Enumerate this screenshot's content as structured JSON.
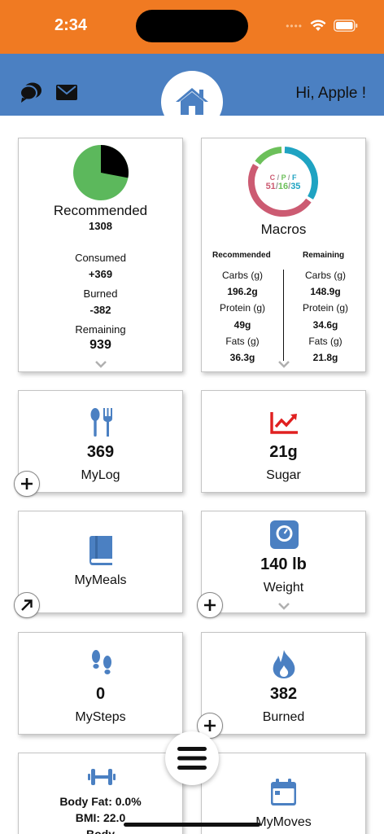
{
  "status_bar": {
    "time": "2:34",
    "bg_color": "#f07a22"
  },
  "header": {
    "greeting": "Hi, Apple !",
    "bg_color": "#4b80c2",
    "left_icons": [
      "chat-bubbles-icon",
      "mail-icon"
    ],
    "center_icon": "home-icon"
  },
  "calories_card": {
    "pie": {
      "consumed_fraction": 0.28,
      "consumed_color": "#000000",
      "remaining_color": "#5cb85c"
    },
    "title": "Recommended",
    "recommended": "1308",
    "consumed_label": "Consumed",
    "consumed": "+369",
    "burned_label": "Burned",
    "burned": "-382",
    "remaining_label": "Remaining",
    "remaining": "939"
  },
  "macros_card": {
    "ring": {
      "carbs_percent": 51,
      "protein_percent": 16,
      "fats_percent": 35,
      "carbs_color": "#cc5b72",
      "protein_color": "#6cc05a",
      "fats_color": "#1fa3c2"
    },
    "ring_header": {
      "c": "C",
      "p": "P",
      "f": "F",
      "sep": " / "
    },
    "ring_values": {
      "c": "51",
      "p": "16",
      "f": "35",
      "sep": "/"
    },
    "title": "Macros",
    "recommended_header": "Recommended",
    "remaining_header": "Remaining",
    "recommended": [
      {
        "label": "Carbs (g)",
        "value": "196.2g"
      },
      {
        "label": "Protein (g)",
        "value": "49g"
      },
      {
        "label": "Fats (g)",
        "value": "36.3g"
      }
    ],
    "remaining": [
      {
        "label": "Carbs (g)",
        "value": "148.9g"
      },
      {
        "label": "Protein (g)",
        "value": "34.6g"
      },
      {
        "label": "Fats (g)",
        "value": "21.8g"
      }
    ]
  },
  "tiles": {
    "mylog": {
      "value": "369",
      "label": "MyLog",
      "icon": "fork-spoon-icon"
    },
    "sugar": {
      "value": "21g",
      "label": "Sugar",
      "icon": "trend-chart-icon"
    },
    "mymeals": {
      "label": "MyMeals",
      "icon": "book-icon"
    },
    "weight": {
      "value": "140 lb",
      "label": "Weight",
      "icon": "scale-icon"
    },
    "mysteps": {
      "value": "0",
      "label": "MySteps",
      "icon": "footprints-icon"
    },
    "burned": {
      "value": "382",
      "label": "Burned",
      "icon": "flame-icon"
    },
    "body": {
      "body_fat": "Body Fat: 0.0%",
      "bmi": "BMI: 22.0",
      "partial": "Body",
      "icon": "dumbbell-icon"
    },
    "mymoves": {
      "label": "MyMoves",
      "icon": "calendar-icon"
    }
  },
  "colors": {
    "accent_blue": "#4b80c2",
    "sugar_red": "#e02020"
  }
}
